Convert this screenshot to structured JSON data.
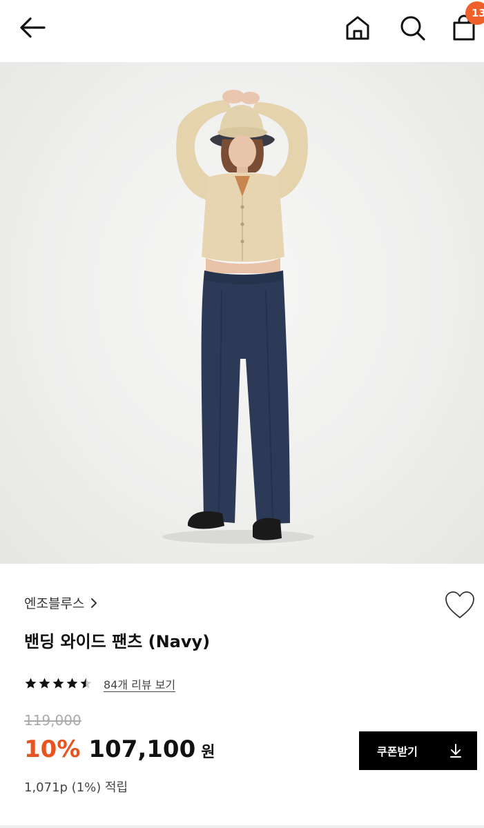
{
  "header": {
    "cart_count": "13"
  },
  "product": {
    "image_alt": "모델이 착용한 밴딩 와이드 팬츠 (Navy)",
    "brand": "엔조블루스",
    "title": "밴딩 와이드 팬츠 (Navy)",
    "rating": 4.5,
    "review_link": "84개 리뷰 보기",
    "original_price": "119,000",
    "discount_percent": "10%",
    "sale_price": "107,100",
    "currency": "원",
    "points": "1,071p (1%) 적립",
    "coupon_button": "쿠폰받기"
  },
  "colors": {
    "accent": "#e8541f",
    "badge": "#f0602a",
    "button_bg": "#000000"
  },
  "icons": [
    "back-arrow-icon",
    "home-icon",
    "search-icon",
    "shopping-bag-icon",
    "chevron-right-icon",
    "heart-icon",
    "star-icon",
    "download-icon"
  ]
}
